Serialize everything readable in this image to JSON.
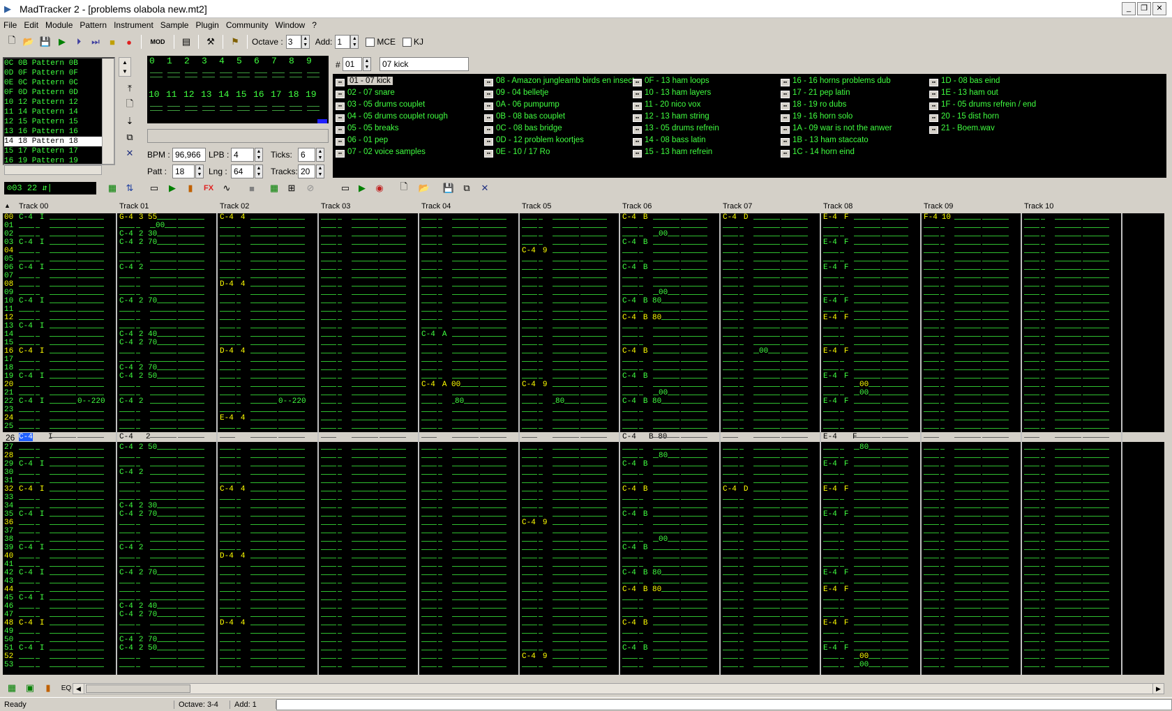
{
  "title": "MadTracker 2 - [problems olabola new.mt2]",
  "menu": [
    "File",
    "Edit",
    "Module",
    "Pattern",
    "Instrument",
    "Sample",
    "Plugin",
    "Community",
    "Window",
    "?"
  ],
  "toolbar": {
    "mode_label": "MOD",
    "octave_label": "Octave :",
    "octave": "3",
    "add_label": "Add:",
    "add": "1",
    "mce": "MCE",
    "kj": "KJ"
  },
  "patterns": [
    {
      "n": "0C",
      "label": "0B Pattern 0B"
    },
    {
      "n": "0D",
      "label": "0F Pattern 0F"
    },
    {
      "n": "0E",
      "label": "0C Pattern 0C"
    },
    {
      "n": "0F",
      "label": "0D Pattern 0D"
    },
    {
      "n": "10",
      "label": "12 Pattern 12"
    },
    {
      "n": "11",
      "label": "14 Pattern 14"
    },
    {
      "n": "12",
      "label": "15 Pattern 15"
    },
    {
      "n": "13",
      "label": "16 Pattern 16"
    },
    {
      "n": "14",
      "label": "18 Pattern 18"
    },
    {
      "n": "15",
      "label": "17 Pattern 17"
    },
    {
      "n": "16",
      "label": "19 Pattern 19"
    }
  ],
  "order": {
    "top": [
      "0",
      "1",
      "2",
      "3",
      "4",
      "5",
      "6",
      "7",
      "8",
      "9"
    ],
    "bottom": [
      "10",
      "11",
      "12",
      "13",
      "14",
      "15",
      "16",
      "17",
      "18",
      "19"
    ]
  },
  "song": {
    "bpm_label": "BPM :",
    "bpm": "96,966",
    "lpb_label": "LPB :",
    "lpb": "4",
    "ticks_label": "Ticks:",
    "ticks": "6",
    "patt_label": "Patt :",
    "patt": "18",
    "lng_label": "Lng :",
    "lng": "64",
    "tracks_label": "Tracks:",
    "tracks": "20",
    "position": "03 22"
  },
  "instrument": {
    "hash": "#",
    "num": "01",
    "name": "07 kick"
  },
  "instruments": [
    [
      "01 - 07 kick",
      "02 - 07 snare",
      "03 - 05 drums couplet",
      "04 - 05 drums couplet rough",
      "05 - 05 breaks",
      "06 - 01 pep",
      "07 - 02 voice samples"
    ],
    [
      "08 - Amazon jungleamb birds en insect",
      "09 - 04 belletje",
      "0A - 06 pumpump",
      "0B - 08 bas couplet",
      "0C - 08 bas bridge",
      "0D - 12 problem koortjes",
      "0E - 10 / 17 Ro"
    ],
    [
      "0F - 13 ham loops",
      "10 - 13 ham layers",
      "11 - 20 nico vox",
      "12 - 13 ham string",
      "13 - 05 drums refrein",
      "14 - 08 bass latin",
      "15 - 13 ham refrein"
    ],
    [
      "16 - 16 horns problems dub",
      "17 - 21 pep latin",
      "18 - 19 ro dubs",
      "19 - 16 horn solo",
      "1A - 09 war is not the anwer",
      "1B - 13 ham staccato",
      "1C - 14 horn eind"
    ],
    [
      "1D - 08 bas eind",
      "1E - 13 ham out",
      "1F - 05 drums refrein / end",
      "20 - 15 dist horn",
      "21 - Boem.wav"
    ]
  ],
  "tracks": [
    "Track 00",
    "Track 01",
    "Track 02",
    "Track 03",
    "Track 04",
    "Track 05",
    "Track 06",
    "Track 07",
    "Track 08",
    "Track 09",
    "Track 10"
  ],
  "rows_top": [
    "00",
    "01",
    "02",
    "03",
    "04",
    "05",
    "06",
    "07",
    "08",
    "09",
    "10",
    "11",
    "12",
    "13",
    "14",
    "15",
    "16",
    "17",
    "18",
    "19",
    "20",
    "21",
    "22",
    "23",
    "24",
    "25"
  ],
  "cursor_row": "26",
  "rows_bottom": [
    "27",
    "28",
    "29",
    "30",
    "31",
    "32",
    "33",
    "34",
    "35",
    "36",
    "37",
    "38",
    "39",
    "40",
    "41",
    "42",
    "43",
    "44",
    "45",
    "46",
    "47",
    "48",
    "49",
    "50",
    "51",
    "52",
    "53"
  ],
  "notes": {
    "kick": "C-4",
    "kick_inst": "I",
    "snare": "C-4",
    "t1a": "G-4",
    "t1a_inst": "3 55",
    "t2": "C-4",
    "t2_inst": "4",
    "t2b": "D-4",
    "t2c": "E-4",
    "v00": "00",
    "t1_270": "2 70",
    "t1_230": "2 30",
    "t1_240": "2 40",
    "t1_250": "2 50",
    "t1_2": "2",
    "t5": "C-4",
    "t5_inst": "9",
    "t4": "C-4",
    "t4a": "A",
    "t4b": "A 00",
    "v80": "80",
    "t6": "C-4",
    "t6_inst": "B",
    "t6_80": "B 80",
    "t7": "C-4",
    "t7_inst": "D",
    "t8": "E-4",
    "t8_inst": "F",
    "t9": "F-4",
    "t9_inst": "10",
    "fx": "0--220"
  },
  "status": {
    "ready": "Ready",
    "octave": "Octave: 3-4",
    "add": "Add: 1"
  }
}
